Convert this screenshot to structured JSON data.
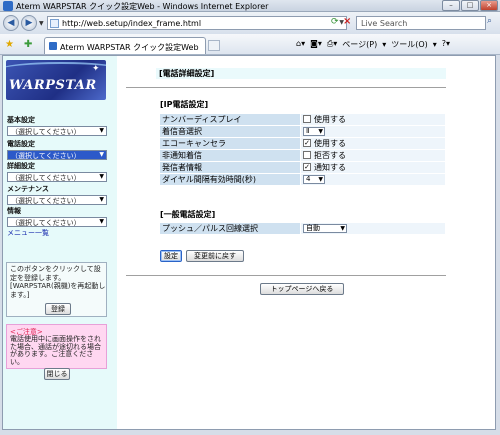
{
  "window": {
    "title": "Aterm WARPSTAR クイック設定Web - Windows Internet Explorer",
    "url": "http://web.setup/index_frame.html",
    "search_placeholder": "Live Search",
    "tab_label": "Aterm WARPSTAR クイック設定Web",
    "cmd_page": "ページ(P)",
    "cmd_tools": "ツール(O)"
  },
  "sidebar": {
    "brand": "WARPSTAR",
    "groups": [
      {
        "label": "基本設定",
        "value": "（選択してください）"
      },
      {
        "label": "電話設定",
        "value": "（選択してください）"
      },
      {
        "label": "詳細設定",
        "value": "（選択してください）"
      },
      {
        "label": "メンテナンス",
        "value": "（選択してください）"
      },
      {
        "label": "情報",
        "value": "（選択してください）"
      }
    ],
    "menu_list": "メニュー一覧",
    "info_text": "このボタンをクリックして設定を登録します。[WARPSTAR(親機)を再起動します。]",
    "register_label": "登録",
    "notice_title": "<ご注意>",
    "notice_text": "電話使用中に画面操作をされた場合、通話が途切れる場合があります。ご注意ください。",
    "close_label": "閉じる"
  },
  "main": {
    "page_title": "[電話詳細設定]",
    "ip_section": "[IP電話設定]",
    "ip_rows": {
      "number_display": {
        "label": "ナンバーディスプレイ",
        "text": "使用する",
        "checked": false
      },
      "ring_tone": {
        "label": "着信音選択",
        "value": "Ⅱ"
      },
      "echo_cancel": {
        "label": "エコーキャンセラ",
        "text": "使用する",
        "checked": true
      },
      "anonymous": {
        "label": "非通知着信",
        "text": "拒否する",
        "checked": false
      },
      "caller_info": {
        "label": "発信者情報",
        "text": "通知する",
        "checked": true
      },
      "dial_interval": {
        "label": "ダイヤル間隔有効時間(秒)",
        "value": "4"
      }
    },
    "general_section": "[一般電話設定]",
    "general_rows": {
      "dial_mode": {
        "label": "プッシュ／パルス回線選択",
        "value": "自動"
      }
    },
    "set_label": "設定",
    "revert_label": "変更前に戻す",
    "top_label": "トップページへ戻る",
    "check_mark": "✓"
  }
}
